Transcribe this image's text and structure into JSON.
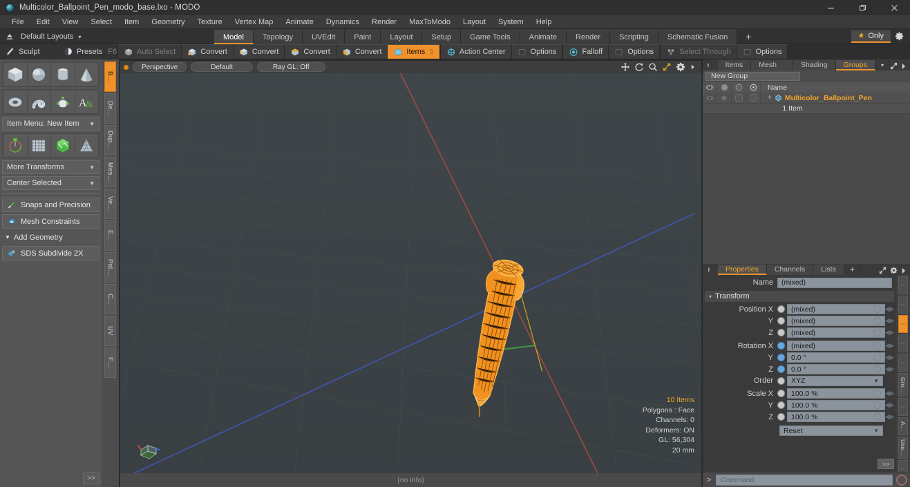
{
  "window": {
    "title": "Multicolor_Ballpoint_Pen_modo_base.lxo - MODO",
    "logo_icon": "modo-logo-icon",
    "minimize": "—",
    "maximize": "❐",
    "close": "✕"
  },
  "menubar": {
    "items": [
      "File",
      "Edit",
      "View",
      "Select",
      "Item",
      "Geometry",
      "Texture",
      "Vertex Map",
      "Animate",
      "Dynamics",
      "Render",
      "MaxToModo",
      "Layout",
      "System",
      "Help"
    ]
  },
  "layoutbar": {
    "up_icon": "up-arrow-icon",
    "layouts_label": "Default Layouts",
    "caret": "▾",
    "tabs": [
      {
        "label": "Model",
        "active": true
      },
      {
        "label": "Topology",
        "active": false
      },
      {
        "label": "UVEdit",
        "active": false
      },
      {
        "label": "Paint",
        "active": false
      },
      {
        "label": "Layout",
        "active": false
      },
      {
        "label": "Setup",
        "active": false
      },
      {
        "label": "Game Tools",
        "active": false
      },
      {
        "label": "Animate",
        "active": false
      },
      {
        "label": "Render",
        "active": false
      },
      {
        "label": "Scripting",
        "active": false
      },
      {
        "label": "Schematic Fusion",
        "active": false
      }
    ],
    "add_tab": "+",
    "only_star": "★",
    "only_label": "Only",
    "gear_icon": "gear-icon"
  },
  "toolbar": {
    "left": [
      {
        "label": "Sculpt",
        "icon": "brush-icon",
        "state": "normal"
      },
      {
        "label": "Presets",
        "icon": "presets-sphere-icon",
        "state": "normal",
        "suffix": "F6"
      }
    ],
    "center": [
      {
        "label": "Auto Select",
        "icon": "cube-grey-icon",
        "state": "dim"
      },
      {
        "label": "Convert",
        "icon": "cube-vertex-icon",
        "state": "normal"
      },
      {
        "label": "Convert",
        "icon": "cube-edge-icon",
        "state": "normal"
      },
      {
        "label": "Convert",
        "icon": "cube-poly-icon",
        "state": "normal"
      },
      {
        "label": "Convert",
        "icon": "cube-material-icon",
        "state": "normal"
      },
      {
        "label": "Items",
        "icon": "items-icon",
        "state": "selected",
        "badge": "5"
      },
      {
        "label": "Action Center",
        "icon": "action-center-icon",
        "state": "normal"
      },
      {
        "label": "Options",
        "icon": "square-toggle-icon",
        "state": "normal"
      },
      {
        "label": "Falloff",
        "icon": "falloff-icon",
        "state": "normal"
      },
      {
        "label": "Options",
        "icon": "square-toggle-icon",
        "state": "normal"
      },
      {
        "label": "Select Through",
        "icon": "select-through-icon",
        "state": "dim"
      },
      {
        "label": "Options",
        "icon": "square-toggle-icon",
        "state": "normal"
      }
    ]
  },
  "left_panel": {
    "primitives_row1": [
      {
        "name": "cube-primitive",
        "icon": "cube-icon"
      },
      {
        "name": "sphere-primitive",
        "icon": "sphere-icon"
      },
      {
        "name": "cylinder-primitive",
        "icon": "cylinder-icon"
      },
      {
        "name": "cone-primitive",
        "icon": "cone-icon"
      }
    ],
    "primitives_row2": [
      {
        "name": "torus-primitive",
        "icon": "torus-icon"
      },
      {
        "name": "tube-primitive",
        "icon": "tube-icon"
      },
      {
        "name": "teapot-primitive",
        "icon": "teapot-icon"
      },
      {
        "name": "text-primitive",
        "icon": "text-icon"
      }
    ],
    "item_menu": "Item Menu: New Item",
    "transform_tools": [
      {
        "name": "transform-tool",
        "icon": "transform-gizmo-icon"
      },
      {
        "name": "grid-tool",
        "icon": "grid-icon"
      },
      {
        "name": "bend-tool",
        "icon": "bend-green-icon"
      },
      {
        "name": "lattice-tool",
        "icon": "lattice-icon"
      }
    ],
    "more_transforms": "More Transforms",
    "center_selected": "Center Selected",
    "snaps": "Snaps and Precision",
    "mesh_constraints": "Mesh Constraints",
    "add_geometry": "Add Geometry",
    "sds_subdivide": "SDS Subdivide 2X",
    "expand_button": ">>",
    "vtabs": [
      {
        "label": "B…",
        "active": true
      },
      {
        "label": "De…",
        "active": false
      },
      {
        "label": "Dup…",
        "active": false
      },
      {
        "label": "Mes…",
        "active": false
      },
      {
        "label": "Ve…",
        "active": false
      },
      {
        "label": "E…",
        "active": false
      },
      {
        "label": "Pol…",
        "active": false
      },
      {
        "label": "C…",
        "active": false
      },
      {
        "label": "UV",
        "active": false
      },
      {
        "label": "F…",
        "active": false
      }
    ]
  },
  "viewport": {
    "projection": "Perspective",
    "shading": "Default",
    "raygl": "Ray GL: Off",
    "icons": [
      "pan-icon",
      "rotate-icon",
      "zoom-icon",
      "fit-icon",
      "gear-icon",
      "expand-arrow-icon"
    ],
    "stats": {
      "items": "10 Items",
      "polygons": "Polygons : Face",
      "channels": "Channels: 0",
      "deformers": "Deformers: ON",
      "gl": "GL: 56,304",
      "scale": "20 mm"
    },
    "axis_gizmo": "axis-gizmo-icon",
    "status": "(no info)"
  },
  "right_top": {
    "tabs": [
      {
        "label": "Items",
        "active": false
      },
      {
        "label": "Mesh …",
        "active": false
      },
      {
        "label": "Shading",
        "active": false
      },
      {
        "label": "Groups",
        "active": true
      }
    ],
    "caret": "▾",
    "expand_icon": "expand-diagonal-icon",
    "more_icon": "chevron-right-icon",
    "new_group_button": "New Group",
    "columns": [
      {
        "name": "visibility-column",
        "icon": "eye-icon"
      },
      {
        "name": "render-column",
        "icon": "moon-icon"
      },
      {
        "name": "lock-column",
        "icon": "circle-1-icon"
      },
      {
        "name": "select-column",
        "icon": "circle-2-icon"
      }
    ],
    "name_header": "Name",
    "rows": [
      {
        "name": "Multicolor_Ballpoint_Pen",
        "sub": "1 Item",
        "icon": "group-icon",
        "expander": "+"
      }
    ]
  },
  "properties": {
    "tabs": [
      {
        "label": "Properties",
        "active": true
      },
      {
        "label": "Channels",
        "active": false
      },
      {
        "label": "Lists",
        "active": false
      }
    ],
    "add_tab": "+",
    "expand_icon": "expand-diagonal-icon",
    "gear_icon": "gear-icon",
    "more_icon": "chevron-right-icon",
    "name_label": "Name",
    "name_value": "(mixed)",
    "transform_section": "Transform",
    "section_caret": "▾",
    "fields": [
      {
        "label": "Position X",
        "value": "(mixed)",
        "radio": "grey",
        "type": "value"
      },
      {
        "label": "Y",
        "value": "(mixed)",
        "radio": "grey",
        "type": "value"
      },
      {
        "label": "Z",
        "value": "(mixed)",
        "radio": "grey",
        "type": "value"
      },
      {
        "label": "Rotation X",
        "value": "(mixed)",
        "radio": "blue",
        "type": "value"
      },
      {
        "label": "Y",
        "value": "0.0 °",
        "radio": "blue",
        "type": "value"
      },
      {
        "label": "Z",
        "value": "0.0 °",
        "radio": "blue",
        "type": "value"
      },
      {
        "label": "Order",
        "value": "XYZ",
        "radio": "grey",
        "type": "dropdown"
      },
      {
        "label": "Scale X",
        "value": "100.0 %",
        "radio": "grey",
        "type": "value"
      },
      {
        "label": "Y",
        "value": "100.0 %",
        "radio": "grey",
        "type": "value"
      },
      {
        "label": "Z",
        "value": "100.0 %",
        "radio": "grey",
        "type": "value"
      }
    ],
    "reset_label": "Reset",
    "expand_button": ">>",
    "vtabs": [
      {
        "label": "⋮",
        "active": false
      },
      {
        "label": "⋮",
        "active": false
      },
      {
        "label": "⋮",
        "active": true
      },
      {
        "label": "⋮",
        "active": false
      },
      {
        "label": "⋮",
        "active": false
      },
      {
        "label": "Gro…",
        "active": false
      },
      {
        "label": "⋮",
        "active": false
      },
      {
        "label": "A…",
        "active": false
      },
      {
        "label": "Use…",
        "active": false
      },
      {
        "label": "⋮",
        "active": false
      }
    ]
  },
  "command_bar": {
    "prompt": ">",
    "placeholder": "Command",
    "record_icon": "record-circle-icon"
  },
  "colors": {
    "accent": "#f0922b",
    "selection": "#f0a52b",
    "panel": "#3a3a3a",
    "viewport_bg": "#3c4245"
  }
}
